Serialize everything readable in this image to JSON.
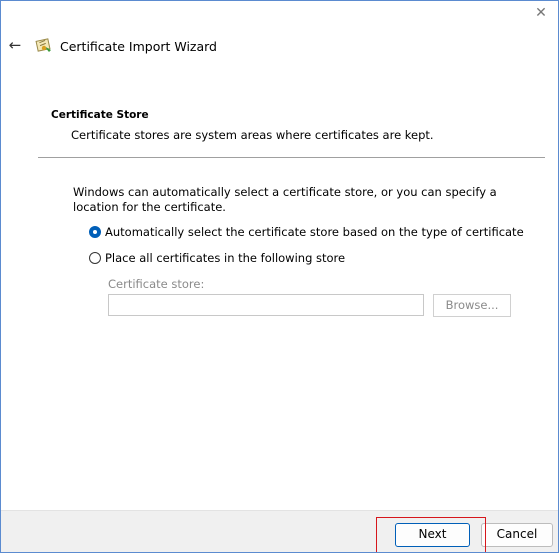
{
  "window": {
    "title": "Certificate Import Wizard",
    "close_glyph": "✕",
    "back_glyph": "←",
    "icons": {
      "close": "close-icon",
      "back": "back-arrow-icon",
      "wizard": "certificate-wizard-icon"
    }
  },
  "page": {
    "section_title": "Certificate Store",
    "section_desc": "Certificate stores are system areas where certificates are kept.",
    "intro": "Windows can automatically select a certificate store, or you can specify a location for the certificate.",
    "options": [
      {
        "label": "Automatically select the certificate store based on the type of certificate",
        "checked": true
      },
      {
        "label": "Place all certificates in the following store",
        "checked": false
      }
    ],
    "store_label": "Certificate store:",
    "store_value": "",
    "browse_label": "Browse..."
  },
  "footer": {
    "next_label": "Next",
    "cancel_label": "Cancel"
  },
  "colors": {
    "accent": "#005fb8",
    "highlight": "#d6161c"
  }
}
